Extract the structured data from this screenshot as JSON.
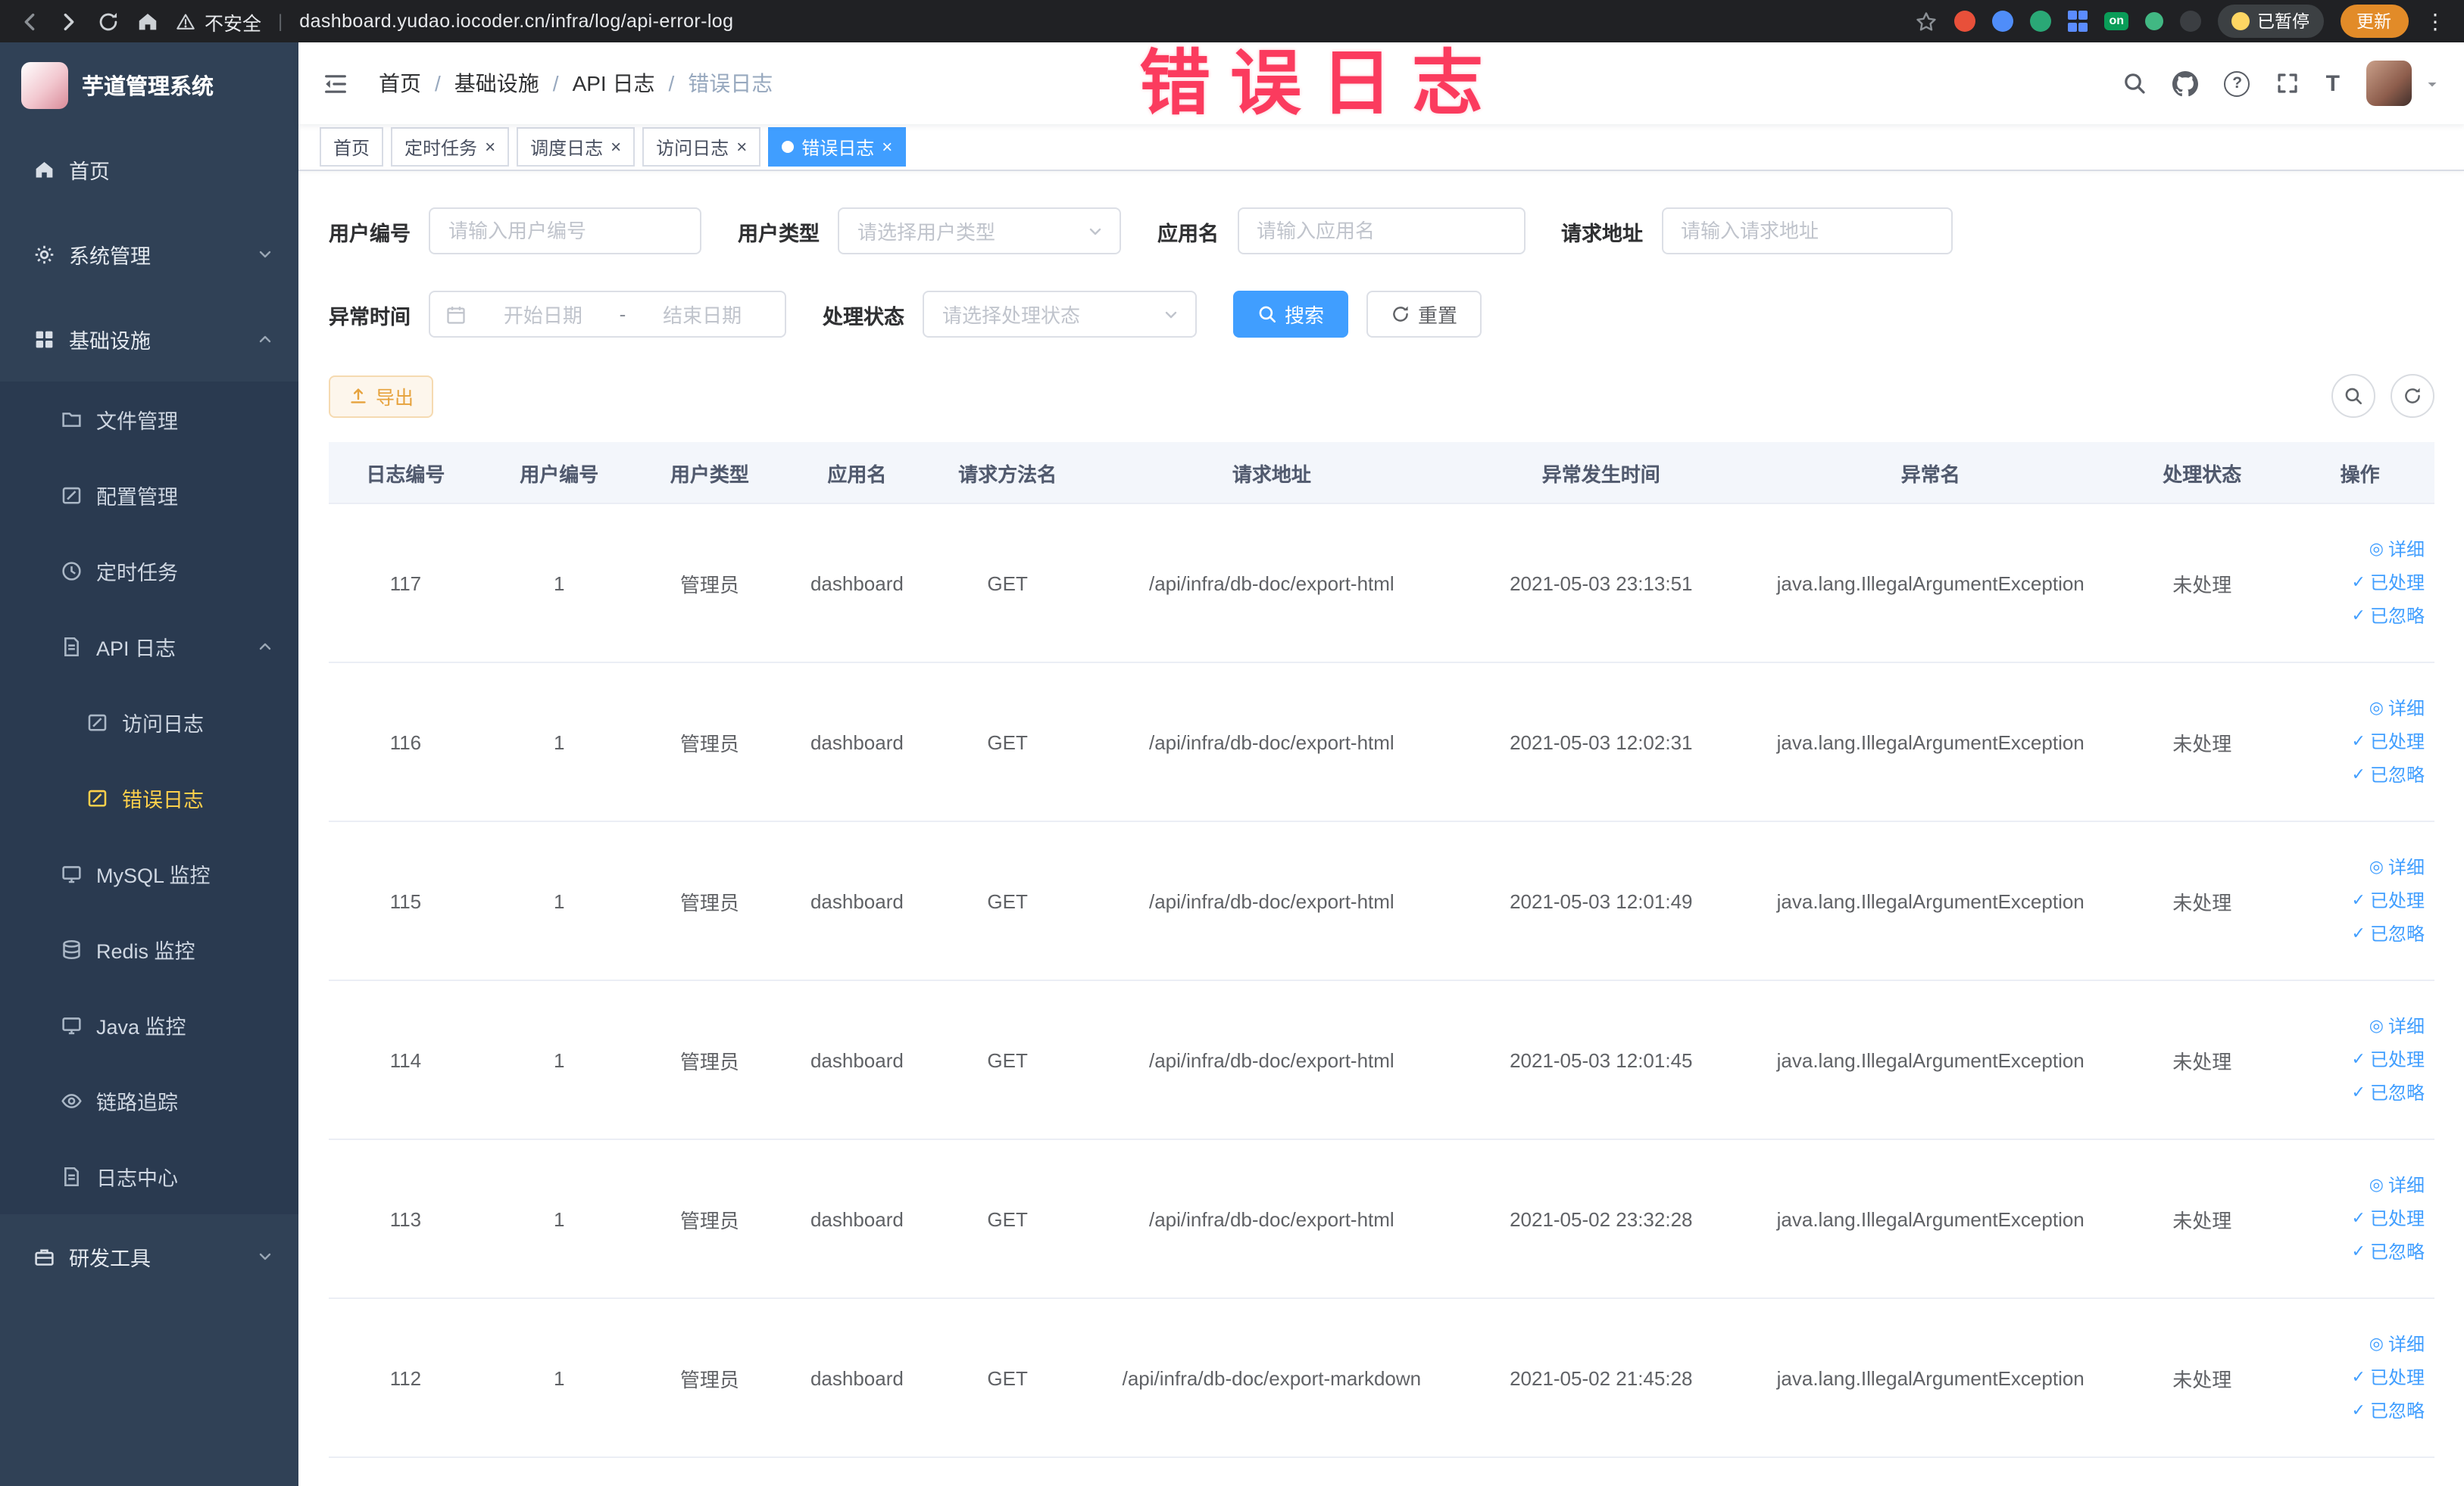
{
  "annotation": {
    "text": "错误日志"
  },
  "browser": {
    "security_label": "不安全",
    "url": "dashboard.yudao.iocoder.cn/infra/log/api-error-log",
    "extension_on_label": "on",
    "paused_label": "已暂停",
    "update_label": "更新"
  },
  "icons": {
    "close": "×",
    "check": "✓",
    "detail": "◎",
    "question": "?",
    "dots": "⋮",
    "font_size": "T"
  },
  "sidebar": {
    "logo_title": "芋道管理系统",
    "items": [
      {
        "label": "首页"
      },
      {
        "label": "系统管理"
      },
      {
        "label": "基础设施"
      },
      {
        "label": "文件管理"
      },
      {
        "label": "配置管理"
      },
      {
        "label": "定时任务"
      },
      {
        "label": "API 日志"
      },
      {
        "label": "访问日志"
      },
      {
        "label": "错误日志"
      },
      {
        "label": "MySQL 监控"
      },
      {
        "label": "Redis 监控"
      },
      {
        "label": "Java 监控"
      },
      {
        "label": "链路追踪"
      },
      {
        "label": "日志中心"
      },
      {
        "label": "研发工具"
      }
    ]
  },
  "breadcrumb": {
    "separator": "/",
    "items": [
      "首页",
      "基础设施",
      "API 日志",
      "错误日志"
    ]
  },
  "tabs": [
    {
      "label": "首页"
    },
    {
      "label": "定时任务"
    },
    {
      "label": "调度日志"
    },
    {
      "label": "访问日志"
    },
    {
      "label": "错误日志"
    }
  ],
  "filters": {
    "user_no": {
      "label": "用户编号",
      "placeholder": "请输入用户编号"
    },
    "user_type": {
      "label": "用户类型",
      "placeholder": "请选择用户类型"
    },
    "app_name": {
      "label": "应用名",
      "placeholder": "请输入应用名"
    },
    "request_url": {
      "label": "请求地址",
      "placeholder": "请输入请求地址"
    },
    "exception_time": {
      "label": "异常时间",
      "start_placeholder": "开始日期",
      "separator": "-",
      "end_placeholder": "结束日期"
    },
    "process_status": {
      "label": "处理状态",
      "placeholder": "请选择处理状态"
    },
    "search_label": "搜索",
    "reset_label": "重置"
  },
  "toolbar": {
    "export_label": "导出"
  },
  "table": {
    "headers": [
      "日志编号",
      "用户编号",
      "用户类型",
      "应用名",
      "请求方法名",
      "请求地址",
      "异常发生时间",
      "异常名",
      "处理状态",
      "操作"
    ],
    "action_labels": [
      "详细",
      "已处理",
      "已忽略"
    ],
    "rows": [
      {
        "log_id": "117",
        "user_id": "1",
        "user_type": "管理员",
        "app_name": "dashboard",
        "method": "GET",
        "url": "/api/infra/db-doc/export-html",
        "time": "2021-05-03 23:13:51",
        "exception": "java.lang.IllegalArgumentException",
        "status": "未处理"
      },
      {
        "log_id": "116",
        "user_id": "1",
        "user_type": "管理员",
        "app_name": "dashboard",
        "method": "GET",
        "url": "/api/infra/db-doc/export-html",
        "time": "2021-05-03 12:02:31",
        "exception": "java.lang.IllegalArgumentException",
        "status": "未处理"
      },
      {
        "log_id": "115",
        "user_id": "1",
        "user_type": "管理员",
        "app_name": "dashboard",
        "method": "GET",
        "url": "/api/infra/db-doc/export-html",
        "time": "2021-05-03 12:01:49",
        "exception": "java.lang.IllegalArgumentException",
        "status": "未处理"
      },
      {
        "log_id": "114",
        "user_id": "1",
        "user_type": "管理员",
        "app_name": "dashboard",
        "method": "GET",
        "url": "/api/infra/db-doc/export-html",
        "time": "2021-05-03 12:01:45",
        "exception": "java.lang.IllegalArgumentException",
        "status": "未处理"
      },
      {
        "log_id": "113",
        "user_id": "1",
        "user_type": "管理员",
        "app_name": "dashboard",
        "method": "GET",
        "url": "/api/infra/db-doc/export-html",
        "time": "2021-05-02 23:32:28",
        "exception": "java.lang.IllegalArgumentException",
        "status": "未处理"
      },
      {
        "log_id": "112",
        "user_id": "1",
        "user_type": "管理员",
        "app_name": "dashboard",
        "method": "GET",
        "url": "/api/infra/db-doc/export-markdown",
        "time": "2021-05-02 21:45:28",
        "exception": "java.lang.IllegalArgumentException",
        "status": "未处理"
      }
    ]
  },
  "colors": {
    "primary": "#409eff",
    "sidebar_bg": "#304156",
    "active_menu_text": "#ffd04b",
    "annotation": "#fb3b5e",
    "warning": "#e6a23c"
  }
}
